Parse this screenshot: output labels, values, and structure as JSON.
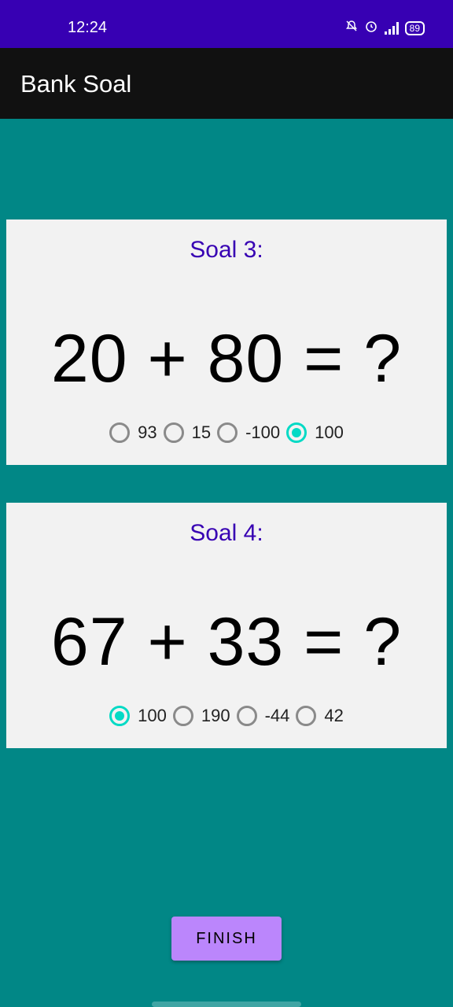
{
  "status_bar": {
    "time": "12:24",
    "battery": "89"
  },
  "app_bar": {
    "title": "Bank Soal"
  },
  "questions": [
    {
      "label": "Soal 3:",
      "equation": "20 + 80 = ?",
      "options": [
        "93",
        "15",
        "-100",
        "100"
      ],
      "selected": "100"
    },
    {
      "label": "Soal 4:",
      "equation": "67 + 33 = ?",
      "options": [
        "100",
        "190",
        "-44",
        "42"
      ],
      "selected": "100"
    }
  ],
  "finish_button": {
    "label": "FINISH"
  },
  "colors": {
    "status_bar": "#3700B3",
    "app_bar": "#111111",
    "background": "#018786",
    "label": "#3700B3",
    "radio_checked": "#03DAC5",
    "button": "#BB86FC"
  }
}
